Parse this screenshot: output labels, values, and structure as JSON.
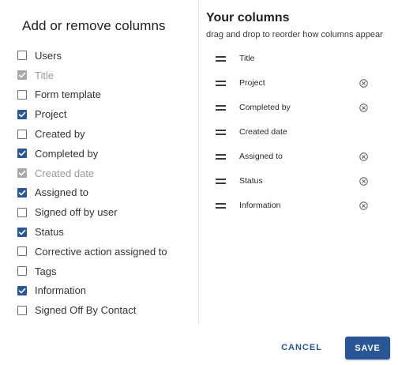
{
  "left_panel": {
    "title": "Add or remove columns",
    "options": [
      {
        "label": "Users",
        "checked": false,
        "disabled": false
      },
      {
        "label": "Title",
        "checked": true,
        "disabled": true
      },
      {
        "label": "Form template",
        "checked": false,
        "disabled": false
      },
      {
        "label": "Project",
        "checked": true,
        "disabled": false
      },
      {
        "label": "Created by",
        "checked": false,
        "disabled": false
      },
      {
        "label": "Completed by",
        "checked": true,
        "disabled": false
      },
      {
        "label": "Created date",
        "checked": true,
        "disabled": true
      },
      {
        "label": "Assigned to",
        "checked": true,
        "disabled": false
      },
      {
        "label": "Signed off by user",
        "checked": false,
        "disabled": false
      },
      {
        "label": "Status",
        "checked": true,
        "disabled": false
      },
      {
        "label": "Corrective action assigned to",
        "checked": false,
        "disabled": false
      },
      {
        "label": "Tags",
        "checked": false,
        "disabled": false
      },
      {
        "label": "Information",
        "checked": true,
        "disabled": false
      },
      {
        "label": "Signed Off By Contact",
        "checked": false,
        "disabled": false
      }
    ]
  },
  "right_panel": {
    "title": "Your columns",
    "subtitle": "drag and drop to reorder how columns appear",
    "columns": [
      {
        "label": "Title",
        "removable": false
      },
      {
        "label": "Project",
        "removable": true
      },
      {
        "label": "Completed by",
        "removable": true
      },
      {
        "label": "Created date",
        "removable": false
      },
      {
        "label": "Assigned to",
        "removable": true
      },
      {
        "label": "Status",
        "removable": true
      },
      {
        "label": "Information",
        "removable": true
      }
    ]
  },
  "footer": {
    "cancel_label": "CANCEL",
    "save_label": "SAVE"
  },
  "colors": {
    "accent": "#2a5596",
    "disabled_text": "#9a9a9a",
    "divider": "#e3e3e3"
  },
  "icons": {
    "checkbox_check": "check-icon",
    "drag_handle": "drag-handle-icon",
    "remove": "remove-circle-icon"
  }
}
